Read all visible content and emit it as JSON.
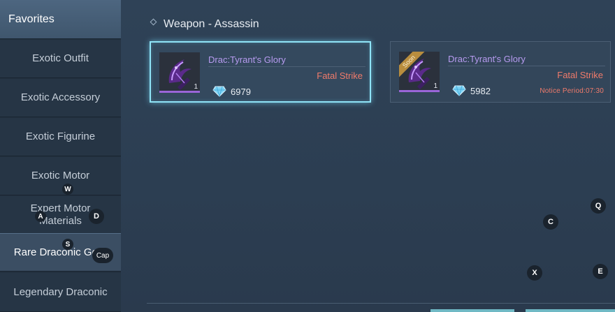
{
  "sidebar": {
    "favorites": "Favorites",
    "items": [
      "Exotic Outfit",
      "Exotic Accessory",
      "Exotic Figurine",
      "Exotic Motor",
      "Expert Motor Materials",
      "Rare Draconic Gear",
      "Legendary Draconic"
    ],
    "active_index": 5
  },
  "main": {
    "title": "Weapon - Assassin",
    "cards": [
      {
        "name": "Drac:Tyrant's Glory",
        "effect": "Fatal Strike",
        "price": "6979",
        "quantity": "1",
        "selected": true,
        "soon_badge": "",
        "notice": ""
      },
      {
        "name": "Drac:Tyrant's Glory",
        "effect": "Fatal Strike",
        "price": "5982",
        "quantity": "1",
        "selected": false,
        "soon_badge": "Soon",
        "notice": "Notice Period:07:30"
      }
    ]
  },
  "key_hints": {
    "w": "W",
    "a": "A",
    "s": "S",
    "d": "D",
    "cap": "Cap",
    "q": "Q",
    "c": "C",
    "x": "X",
    "e": "E"
  },
  "colors": {
    "accent_selected": "#8fe4f7",
    "item_name": "#b79bf0",
    "effect_text": "#f07b6b",
    "background": "#2f4257"
  },
  "icons": [
    "diamond-bullet-icon",
    "gem-currency-icon",
    "scythe-weapon-icon"
  ]
}
